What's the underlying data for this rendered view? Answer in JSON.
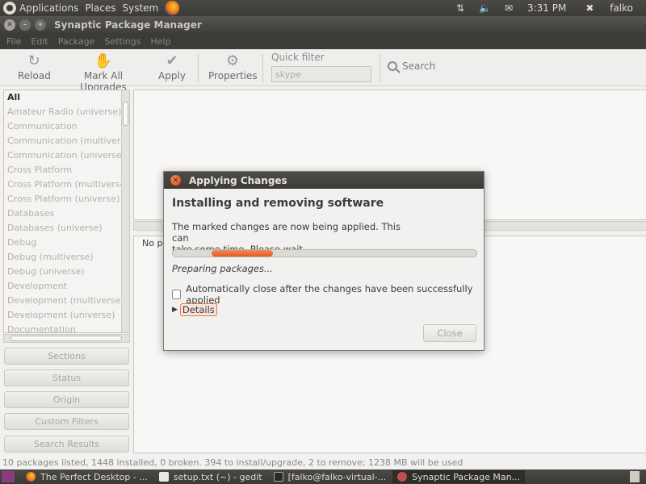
{
  "top_panel": {
    "menus": [
      "Applications",
      "Places",
      "System"
    ],
    "clock": "3:31 PM",
    "user": "falko"
  },
  "window": {
    "title": "Synaptic Package Manager"
  },
  "menubar": {
    "items": [
      "File",
      "Edit",
      "Package",
      "Settings",
      "Help"
    ]
  },
  "toolbar": {
    "reload": "Reload",
    "mark_all": "Mark All Upgrades",
    "apply": "Apply",
    "properties": "Properties",
    "quick_filter_label": "Quick filter",
    "quick_filter_value": "skype",
    "search": "Search"
  },
  "sections": {
    "items": [
      "All",
      "Amateur Radio (universe)",
      "Communication",
      "Communication (multiverse)",
      "Communication (universe)",
      "Cross Platform",
      "Cross Platform (multiverse)",
      "Cross Platform (universe)",
      "Databases",
      "Databases (universe)",
      "Debug",
      "Debug (multiverse)",
      "Debug (universe)",
      "Development",
      "Development (multiverse)",
      "Development (universe)",
      "Documentation"
    ],
    "selected_index": 0
  },
  "filter_buttons": {
    "sections": "Sections",
    "status": "Status",
    "origin": "Origin",
    "custom": "Custom Filters",
    "search_results": "Search Results"
  },
  "description_pane": {
    "text": "No p"
  },
  "statusbar": {
    "text": "10 packages listed, 1448 installed, 0 broken. 394 to install/upgrade, 2 to remove; 1238 MB will be used"
  },
  "dialog": {
    "title": "Applying Changes",
    "heading": "Installing and removing software",
    "message_line1": "The marked changes are now being applied. This can",
    "message_line2": "take some time. Please wait.",
    "status": "Preparing packages...",
    "auto_close_label": "Automatically close after the changes have been successfully applied",
    "auto_close_checked": false,
    "details_label": "Details",
    "close_label": "Close",
    "accent_color": "#e05a25"
  },
  "taskbar": {
    "tasks": [
      "The Perfect Desktop - ...",
      "setup.txt (~) - gedit",
      "[falko@falko-virtual-...",
      "Synaptic Package Man..."
    ]
  }
}
